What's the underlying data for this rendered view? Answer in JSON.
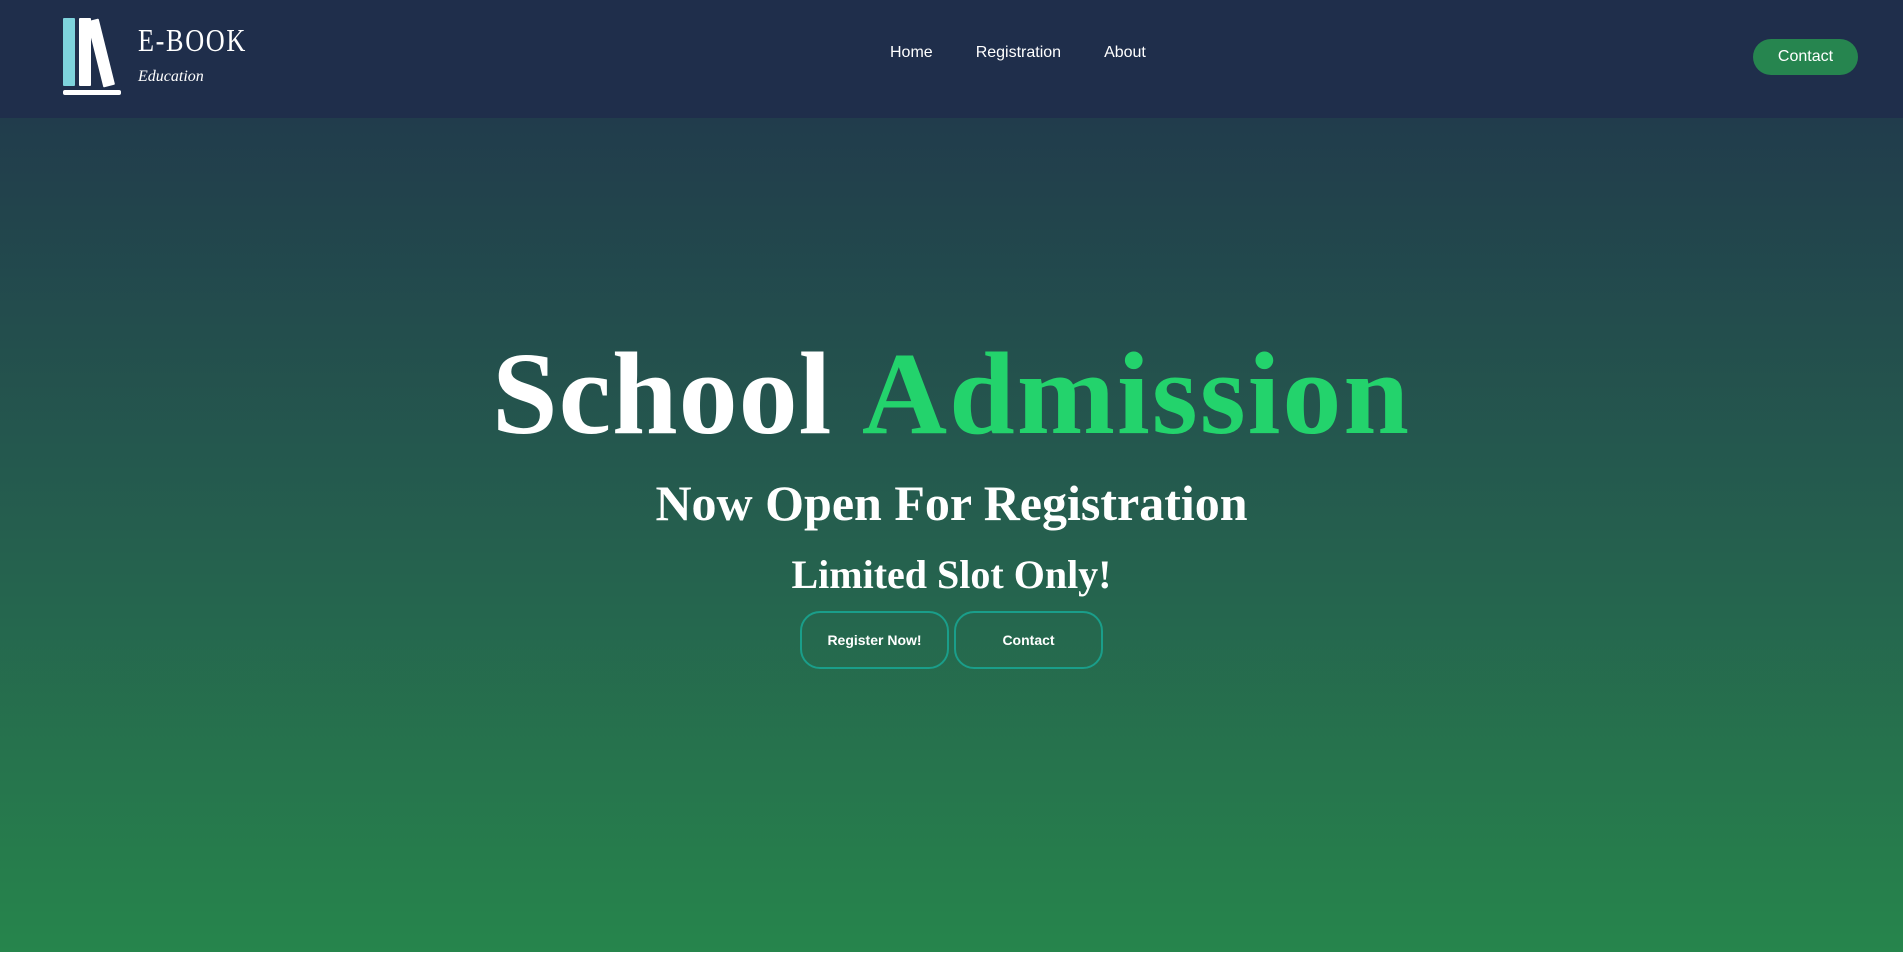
{
  "brand": {
    "name": "E-BOOK",
    "tagline": "Education",
    "logo_icon": "books-icon"
  },
  "nav": {
    "items": [
      {
        "label": "Home"
      },
      {
        "label": "Registration"
      },
      {
        "label": "About"
      }
    ],
    "contact_label": "Contact"
  },
  "hero": {
    "title_plain": "School",
    "title_accent": "Admission",
    "subtitle": "Now Open For Registration",
    "subtitle2": "Limited Slot Only!",
    "register_label": "Register Now!",
    "contact_label": "Contact"
  },
  "colors": {
    "navbar": "#1f2e4b",
    "accent_green": "#23d36c",
    "button_green": "#26854f",
    "outline_teal": "#1a9e8a",
    "gradient_top": "#213c4c",
    "gradient_bottom": "#26854c"
  }
}
